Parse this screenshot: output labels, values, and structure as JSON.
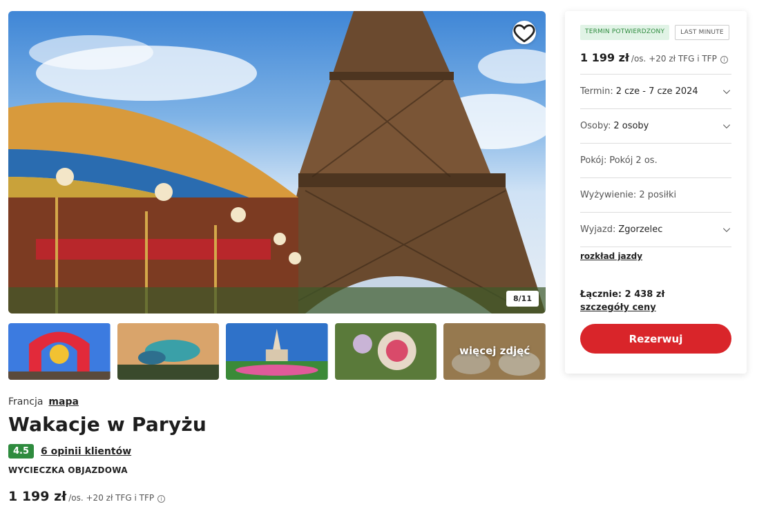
{
  "gallery": {
    "counter": "8/11",
    "more_label": "więcej zdjęć"
  },
  "info": {
    "country": "Francja",
    "map_link": "mapa",
    "title": "Wakacje w Paryżu",
    "rating": "4.5",
    "reviews_link": "6 opinii klientów",
    "trip_type": "WYCIECZKA OBJAZDOWA",
    "price": "1 199 zł",
    "price_suffix": "/os. +20 zł TFG i TFP"
  },
  "card": {
    "badge_confirmed": "TERMIN POTWIERDZONY",
    "badge_last_minute": "LAST MINUTE",
    "price": "1 199 zł",
    "price_suffix": "/os. +20 zł TFG i TFP",
    "options": [
      {
        "label": "Termin:",
        "value": "2 cze - 7 cze 2024"
      },
      {
        "label": "Osoby:",
        "value": "2 osoby"
      },
      {
        "label": "Pokój:",
        "value": "Pokój 2 os."
      },
      {
        "label": "Wyżywienie:",
        "value": "2 posiłki"
      },
      {
        "label": "Wyjazd:",
        "value": "Zgorzelec"
      }
    ],
    "schedule_link": "rozkład jazdy",
    "total": "Łącznie: 2 438 zł",
    "price_details_link": "szczegóły ceny",
    "book_button": "Rezerwuj"
  },
  "colors": {
    "accent_red": "#d9252a",
    "rating_green": "#2e8b3e"
  }
}
